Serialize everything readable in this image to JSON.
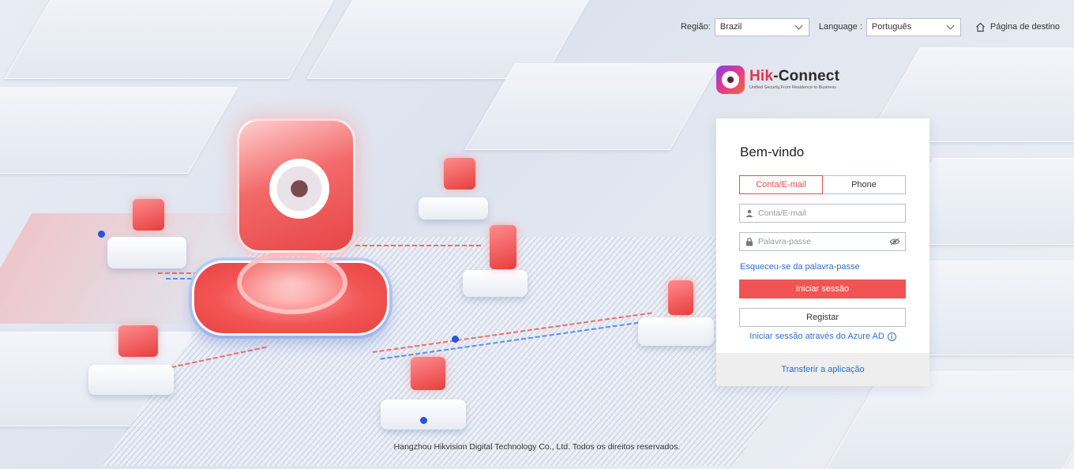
{
  "topbar": {
    "region_label": "Região:",
    "region_value": "Brazil",
    "language_label": "Language :",
    "language_value": "Português",
    "home_link": "Página de destino"
  },
  "logo": {
    "name_part1": "Hik",
    "name_part2": "-Connect",
    "tagline": "Unified Security,From Residence to Business"
  },
  "login": {
    "title": "Bem-vindo",
    "tabs": [
      {
        "label": "Conta/E-mail",
        "active": true
      },
      {
        "label": "Phone",
        "active": false
      }
    ],
    "account_placeholder": "Conta/E-mail",
    "password_placeholder": "Palavra-passe",
    "forgot_link": "Esqueceu-se da palavra-passe",
    "login_button": "Iniciar sessão",
    "register_button": "Registar",
    "azure_link": "Iniciar sessão através do Azure AD",
    "download_link": "Transferir a aplicação"
  },
  "footer": {
    "copyright": "Hangzhou Hikvision Digital Technology Co., Ltd. Todos os direitos reservados."
  },
  "colors": {
    "accent": "#f15454",
    "link": "#2a6fd6"
  }
}
